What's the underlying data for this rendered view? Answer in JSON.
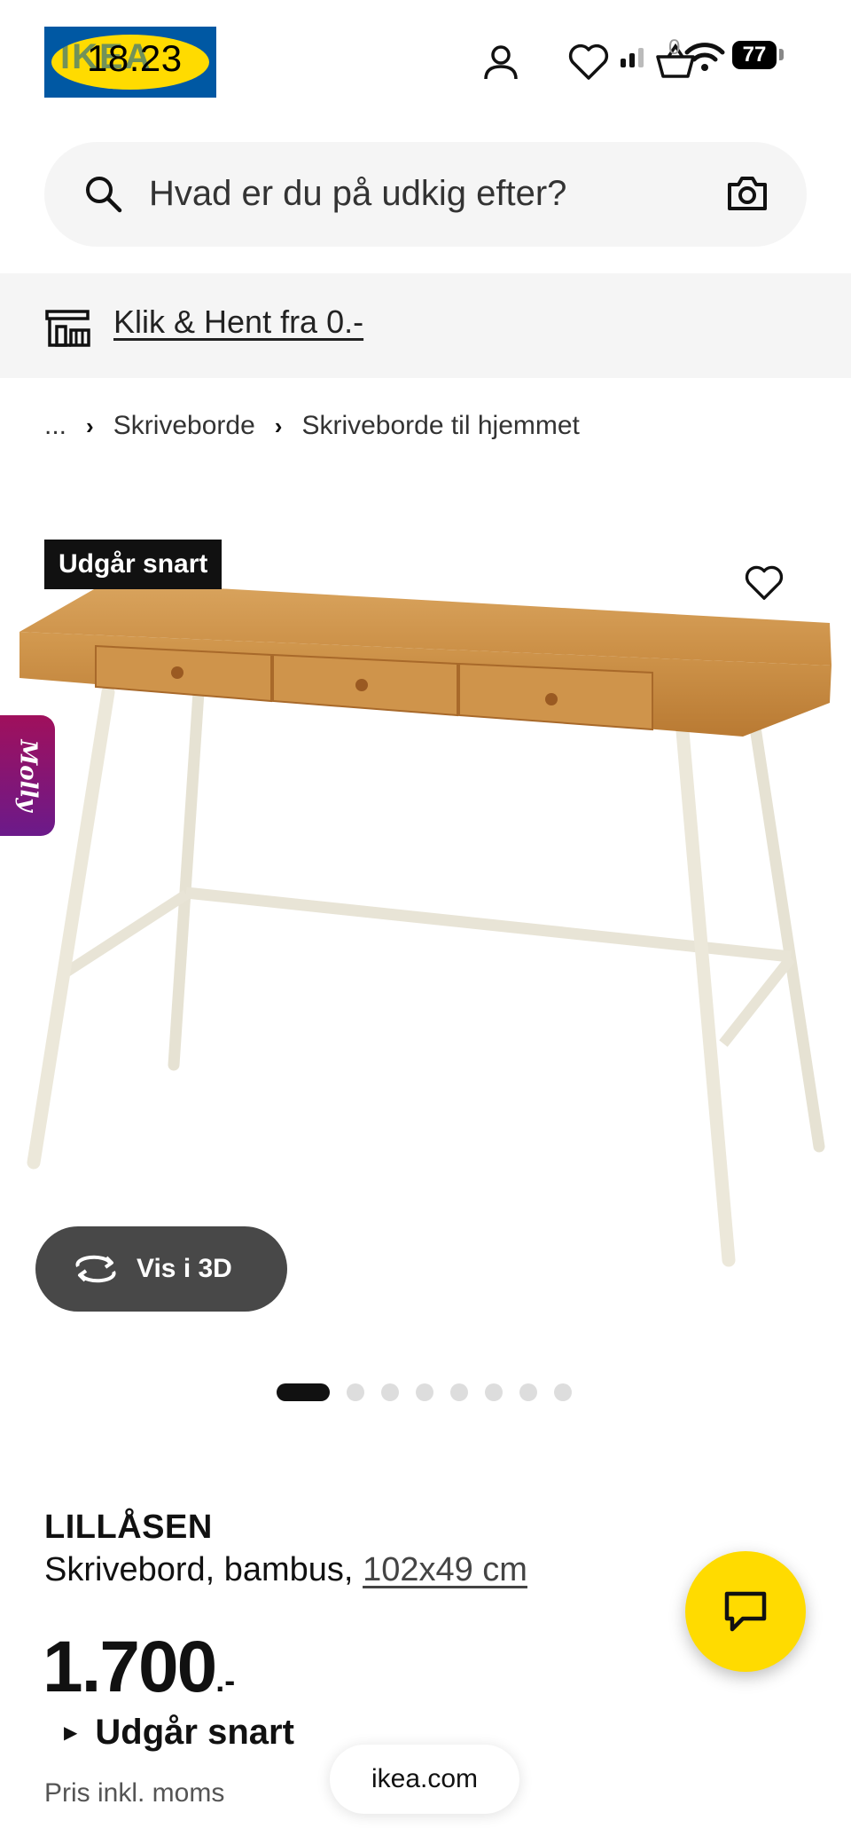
{
  "status_bar": {
    "time": "18.23",
    "battery": "77"
  },
  "header": {
    "logo_text": "IKEA",
    "cart_count": "0"
  },
  "search": {
    "placeholder": "Hvad er du på udkig efter?"
  },
  "banner": {
    "link_text": "Klik & Hent fra 0.-"
  },
  "breadcrumb": {
    "ellipsis": "...",
    "items": [
      "Skriveborde",
      "Skriveborde til hjemmet"
    ]
  },
  "product": {
    "badge": "Udgår snart",
    "view_3d_label": "Vis i 3D",
    "side_tab": "Molly",
    "gallery_count": 8,
    "gallery_active": 1,
    "name": "LILLÅSEN",
    "description": "Skrivebord, bambus, ",
    "dimensions": "102x49 cm",
    "price": "1.700",
    "price_suffix": ".-",
    "availability": "Udgår snart",
    "vat_note": "Pris inkl. moms"
  },
  "browser": {
    "url": "ikea.com"
  },
  "colors": {
    "ikea_blue": "#0058a3",
    "ikea_yellow": "#ffdb00",
    "molly_gradient_start": "#a0105c",
    "molly_gradient_end": "#6b1a8a"
  }
}
